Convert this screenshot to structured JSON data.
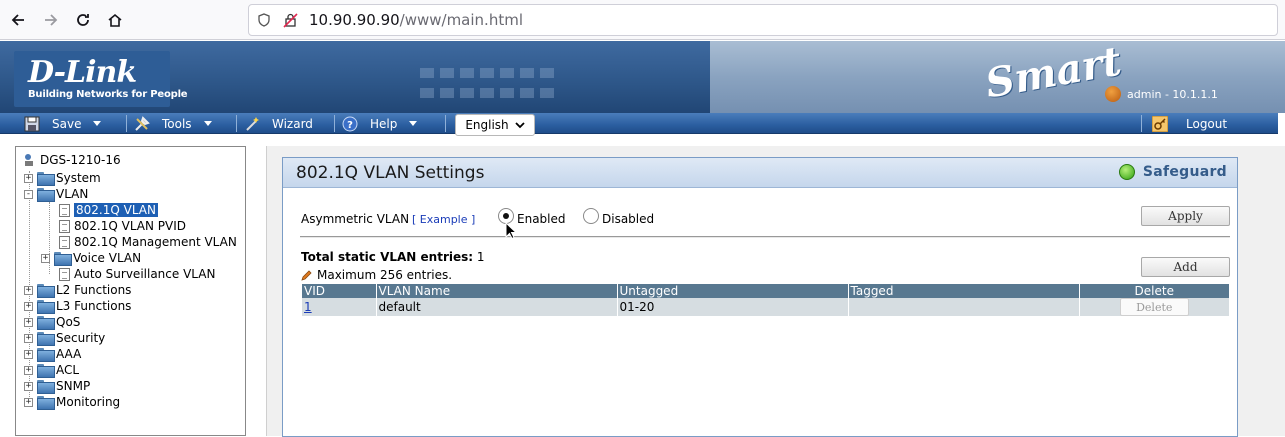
{
  "browser": {
    "url_host": "10.90.90.90",
    "url_path": "/www/main.html"
  },
  "banner": {
    "logo_title": "D-Link",
    "logo_subtitle": "Building Networks for People",
    "smart_text": "Smart",
    "admin_label": "admin - 10.1.1.1"
  },
  "menu": {
    "save": "Save",
    "tools": "Tools",
    "wizard": "Wizard",
    "help": "Help",
    "language": "English",
    "logout": "Logout"
  },
  "tree": {
    "root": "DGS-1210-16",
    "items": [
      {
        "label": "System"
      },
      {
        "label": "VLAN"
      },
      {
        "label": "802.1Q VLAN"
      },
      {
        "label": "802.1Q VLAN PVID"
      },
      {
        "label": "802.1Q Management VLAN"
      },
      {
        "label": "Voice VLAN"
      },
      {
        "label": "Auto Surveillance VLAN"
      },
      {
        "label": "L2 Functions"
      },
      {
        "label": "L3 Functions"
      },
      {
        "label": "QoS"
      },
      {
        "label": "Security"
      },
      {
        "label": "AAA"
      },
      {
        "label": "ACL"
      },
      {
        "label": "SNMP"
      },
      {
        "label": "Monitoring"
      }
    ]
  },
  "settings": {
    "title": "802.1Q VLAN Settings",
    "safeguard": "Safeguard",
    "asym_label": "Asymmetric VLAN",
    "example_link": "[ Example ]",
    "enabled": "Enabled",
    "disabled": "Disabled",
    "apply": "Apply",
    "total_label": "Total static VLAN entries:",
    "total_value": "1",
    "max_entries": "Maximum 256 entries.",
    "add": "Add",
    "table": {
      "headers": [
        "VID",
        "VLAN Name",
        "Untagged",
        "Tagged",
        "Delete"
      ],
      "rows": [
        {
          "vid": "1",
          "name": "default",
          "untagged": "01-20",
          "tagged": "",
          "delete": "Delete"
        }
      ]
    }
  }
}
